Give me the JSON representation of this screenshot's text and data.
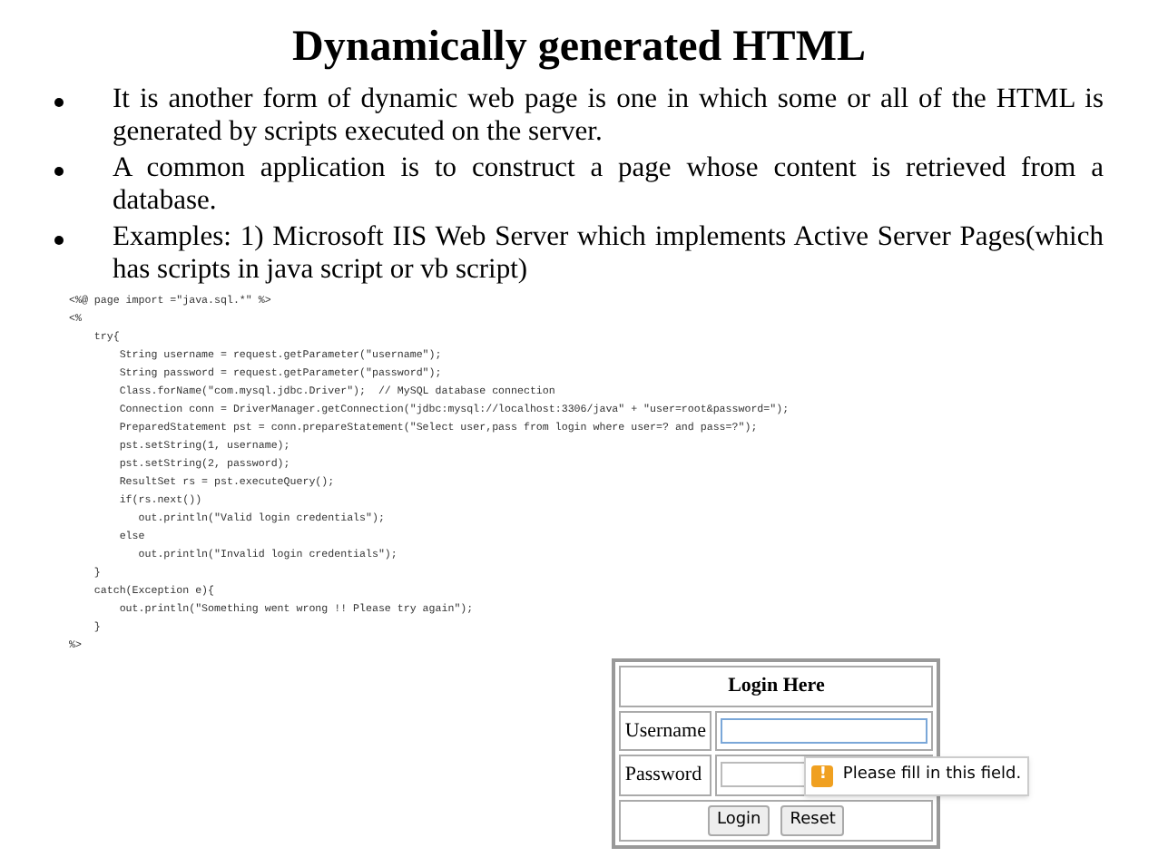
{
  "title": "Dynamically generated HTML",
  "bullets": [
    "It is another form of dynamic web page is one in which some or all of the HTML is generated by scripts executed on the server.",
    "A common application is to construct a page whose content is retrieved from a database.",
    "Examples: 1) Microsoft IIS Web Server which implements Active Server Pages(which has scripts in java script or vb script)"
  ],
  "code_lines": [
    "<%@ page import =\"java.sql.*\" %>",
    "<%",
    "    try{",
    "        String username = request.getParameter(\"username\");",
    "        String password = request.getParameter(\"password\");",
    "        Class.forName(\"com.mysql.jdbc.Driver\");  // MySQL database connection",
    "        Connection conn = DriverManager.getConnection(\"jdbc:mysql://localhost:3306/java\" + \"user=root&password=\");",
    "        PreparedStatement pst = conn.prepareStatement(\"Select user,pass from login where user=? and pass=?\");",
    "        pst.setString(1, username);",
    "        pst.setString(2, password);",
    "        ResultSet rs = pst.executeQuery();",
    "        if(rs.next())",
    "           out.println(\"Valid login credentials\");",
    "        else",
    "           out.println(\"Invalid login credentials\");",
    "    }",
    "    catch(Exception e){",
    "        out.println(\"Something went wrong !! Please try again\");",
    "    }",
    "%>"
  ],
  "login_form": {
    "heading": "Login Here",
    "fields": [
      {
        "label": "Username",
        "focused": true
      },
      {
        "label": "Password",
        "focused": false
      }
    ],
    "tooltip": {
      "icon": "!",
      "text": "Please fill in this field."
    },
    "buttons": [
      "Login",
      "Reset"
    ]
  }
}
